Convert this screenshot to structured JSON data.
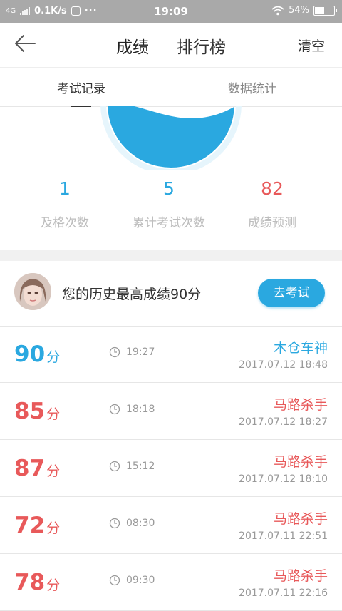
{
  "status_bar": {
    "network": "4G",
    "speed": "0.1K/s",
    "more": "···",
    "time": "19:09",
    "battery_text": "54%",
    "battery_level": 0.54
  },
  "nav": {
    "tabs": [
      {
        "label": "成绩",
        "active": true
      },
      {
        "label": "排行榜",
        "active": false
      }
    ],
    "clear_label": "清空"
  },
  "sub_tabs": [
    {
      "label": "考试记录",
      "active": true
    },
    {
      "label": "数据统计",
      "active": false
    }
  ],
  "stats": [
    {
      "value": "1",
      "label": "及格次数"
    },
    {
      "value": "5",
      "label": "累计考试次数"
    },
    {
      "value": "82",
      "label": "成绩预测"
    }
  ],
  "best": {
    "text": "您的历史最高成绩90分",
    "button": "去考试"
  },
  "records": [
    {
      "score": "90",
      "unit": "分",
      "duration": "19:27",
      "title": "木仓车神",
      "date": "2017.07.12  18:48",
      "color": "blue"
    },
    {
      "score": "85",
      "unit": "分",
      "duration": "18:18",
      "title": "马路杀手",
      "date": "2017.07.12  18:27",
      "color": "red"
    },
    {
      "score": "87",
      "unit": "分",
      "duration": "15:12",
      "title": "马路杀手",
      "date": "2017.07.12  18:10",
      "color": "red"
    },
    {
      "score": "72",
      "unit": "分",
      "duration": "08:30",
      "title": "马路杀手",
      "date": "2017.07.11  22:51",
      "color": "red"
    },
    {
      "score": "78",
      "unit": "分",
      "duration": "09:30",
      "title": "马路杀手",
      "date": "2017.07.11  22:16",
      "color": "red"
    }
  ],
  "colors": {
    "accent_blue": "#2aa8e0",
    "accent_red": "#e8595a",
    "status_bar": "#a9a9a9"
  }
}
